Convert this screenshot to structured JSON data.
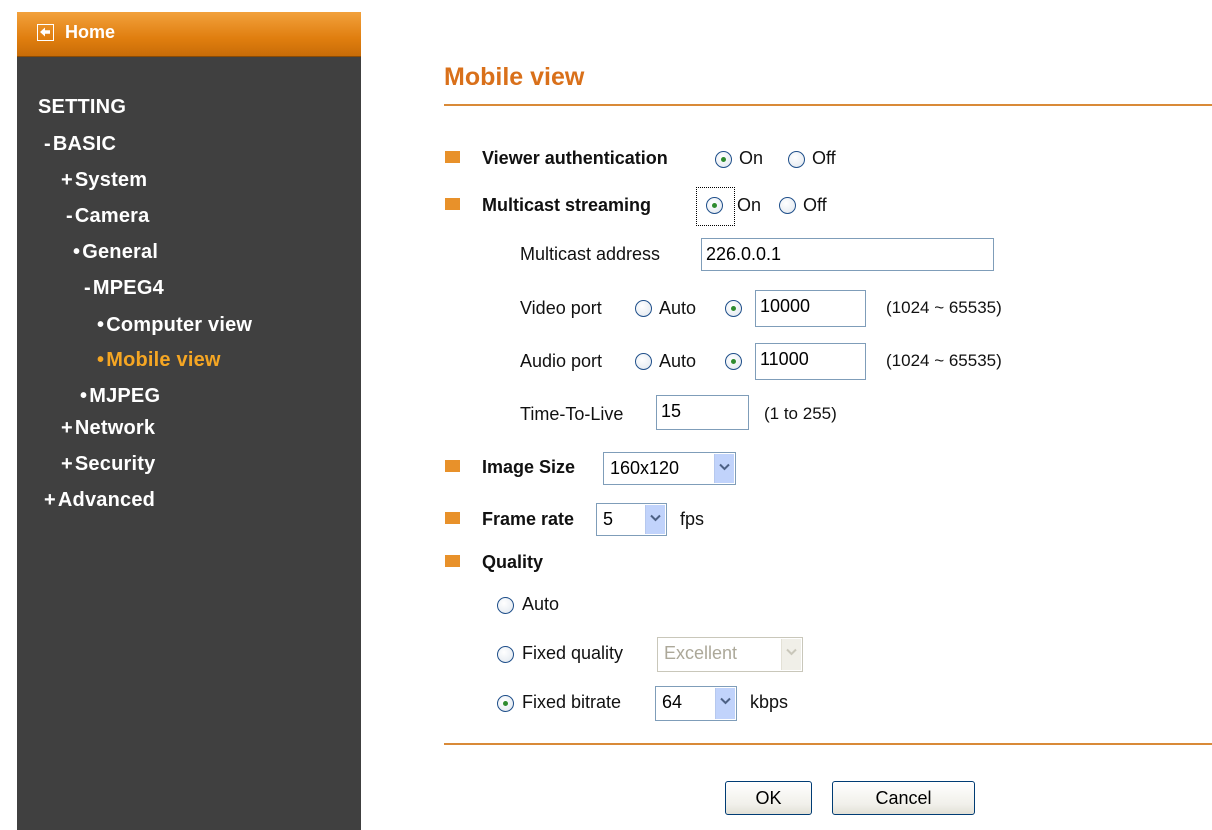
{
  "sidebar": {
    "home_label": "Home",
    "items": [
      {
        "prefix": "",
        "label": "SETTING"
      },
      {
        "prefix": "-",
        "label": "BASIC"
      },
      {
        "prefix": "+",
        "label": "System"
      },
      {
        "prefix": "-",
        "label": "Camera"
      },
      {
        "prefix": "•",
        "label": "General"
      },
      {
        "prefix": "-",
        "label": "MPEG4"
      },
      {
        "prefix": "•",
        "label": "Computer view"
      },
      {
        "prefix": "•",
        "label": "Mobile view"
      },
      {
        "prefix": "•",
        "label": "MJPEG"
      },
      {
        "prefix": "+",
        "label": "Network"
      },
      {
        "prefix": "+",
        "label": "Security"
      },
      {
        "prefix": "+",
        "label": "Advanced"
      }
    ],
    "active_item": "Mobile view",
    "colors": {
      "background": "#404040",
      "home_bar": "#e07e0f",
      "active": "#f5a623"
    }
  },
  "main": {
    "title": "Mobile view",
    "viewer_auth": {
      "label": "Viewer authentication",
      "on": "On",
      "off": "Off",
      "selected": "On"
    },
    "multicast": {
      "label": "Multicast streaming",
      "on": "On",
      "off": "Off",
      "selected": "On",
      "address_label": "Multicast address",
      "address_value": "226.0.0.1",
      "video_port_label": "Video port",
      "video_auto": "Auto",
      "video_value": "10000",
      "video_range": "(1024 ~ 65535)",
      "audio_port_label": "Audio port",
      "audio_auto": "Auto",
      "audio_value": "11000",
      "audio_range": "(1024 ~ 65535)",
      "ttl_label": "Time-To-Live",
      "ttl_value": "15",
      "ttl_range": "(1 to 255)"
    },
    "image_size": {
      "label": "Image Size",
      "value": "160x120"
    },
    "frame_rate": {
      "label": "Frame rate",
      "value": "5",
      "unit": "fps"
    },
    "quality": {
      "label": "Quality",
      "auto": "Auto",
      "fixed_quality_label": "Fixed quality",
      "fixed_quality_value": "Excellent",
      "fixed_bitrate_label": "Fixed bitrate",
      "fixed_bitrate_value": "64",
      "fixed_bitrate_unit": "kbps",
      "selected": "Fixed bitrate"
    },
    "buttons": {
      "ok": "OK",
      "cancel": "Cancel"
    },
    "colors": {
      "title": "#d9701a",
      "rule": "#d98a38",
      "bullet": "#e8912a"
    }
  }
}
